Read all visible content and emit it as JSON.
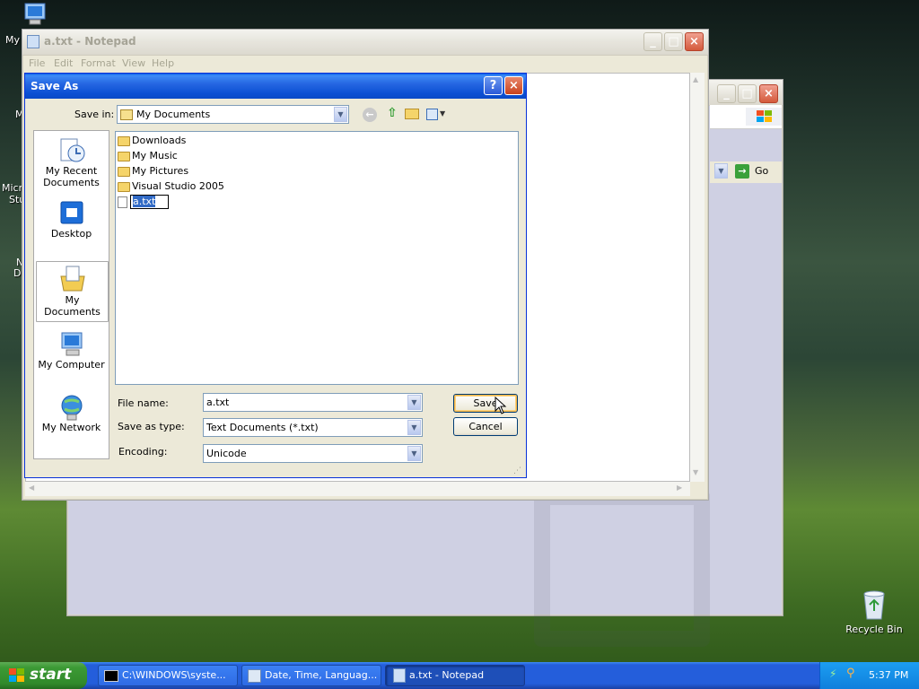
{
  "desktop": {
    "icons": [
      {
        "id": "my-computer-partial",
        "label": "My"
      },
      {
        "id": "recycle-bin",
        "label": "Recycle Bin"
      }
    ],
    "partials": [
      "M",
      "Micr",
      "Stu",
      "N",
      "D"
    ]
  },
  "notepad": {
    "title": "a.txt - Notepad",
    "menu": [
      "File",
      "Edit",
      "Format",
      "View",
      "Help"
    ]
  },
  "background_window": {
    "go_label": "Go"
  },
  "save_as": {
    "title": "Save As",
    "help_glyph": "?",
    "save_in_label": "Save in:",
    "save_in_value": "My Documents",
    "places": [
      {
        "label": "My Recent Documents",
        "icon": "recent-documents-icon"
      },
      {
        "label": "Desktop",
        "icon": "desktop-icon"
      },
      {
        "label": "My Documents",
        "icon": "my-documents-icon",
        "selected": true
      },
      {
        "label": "My Computer",
        "icon": "my-computer-icon"
      },
      {
        "label": "My Network",
        "icon": "network-icon"
      }
    ],
    "files": [
      {
        "name": "Downloads",
        "type": "folder"
      },
      {
        "name": "My Music",
        "type": "folder"
      },
      {
        "name": "My Pictures",
        "type": "folder"
      },
      {
        "name": "Visual Studio 2005",
        "type": "folder"
      },
      {
        "name": "a.txt",
        "type": "text-file",
        "editing": true
      }
    ],
    "file_name_label": "File name:",
    "file_name_value": "a.txt",
    "save_as_type_label": "Save as type:",
    "save_as_type_value": "Text Documents (*.txt)",
    "encoding_label": "Encoding:",
    "encoding_value": "Unicode",
    "save_button": "Save",
    "cancel_button": "Cancel"
  },
  "taskbar": {
    "start_label": "start",
    "tasks": [
      {
        "label": "C:\\WINDOWS\\syste...",
        "active": false
      },
      {
        "label": "Date, Time, Languag...",
        "active": false
      },
      {
        "label": "a.txt - Notepad",
        "active": true
      }
    ],
    "clock": "5:37 PM"
  },
  "colors": {
    "title_active": "#0a5fe8",
    "taskbar": "#245edb",
    "start_green": "#3c9a35",
    "dialog_bg": "#ece9d8"
  }
}
